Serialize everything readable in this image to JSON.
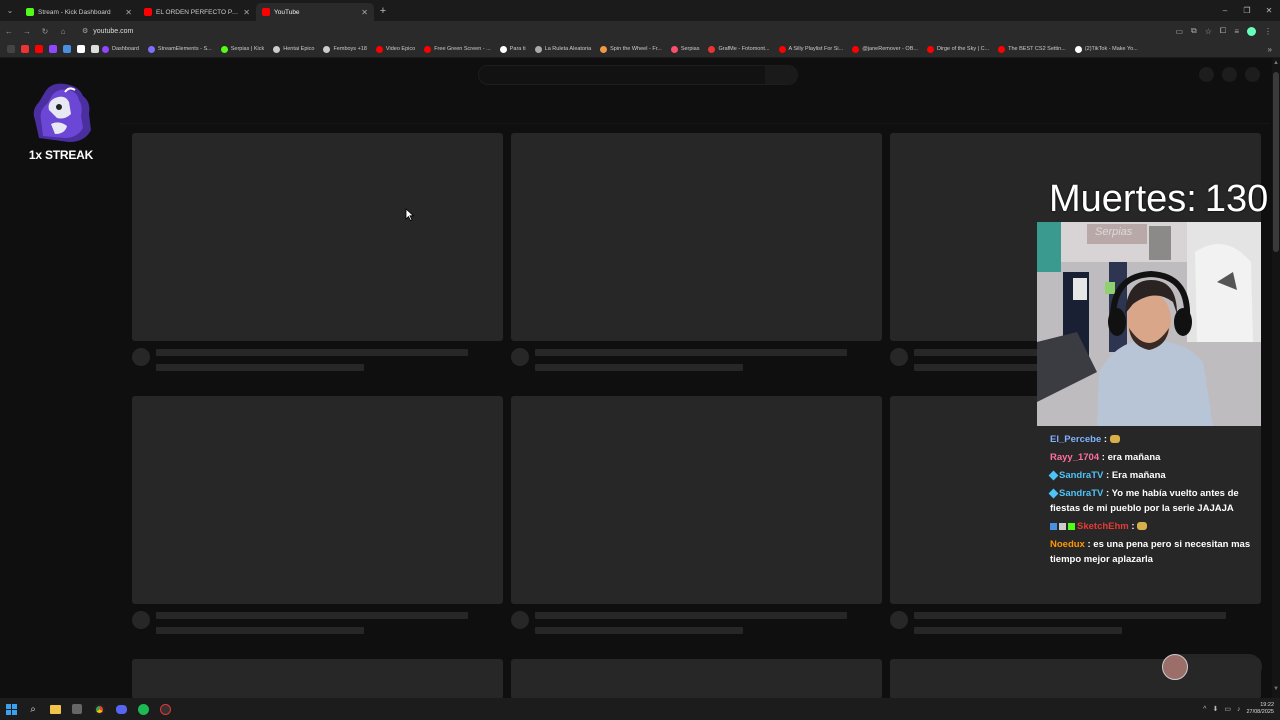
{
  "browser": {
    "tabs": [
      {
        "title": "Stream - Kick Dashboard",
        "favicon_color": "#53fc18",
        "active": false
      },
      {
        "title": "EL ORDEN PERFECTO PARA JU",
        "favicon_color": "#ff0000",
        "active": false
      },
      {
        "title": "YouTube",
        "favicon_color": "#ff0000",
        "active": true
      }
    ],
    "url": "youtube.com",
    "bookmarks": [
      {
        "label": "Dashboard",
        "color": "#9146ff"
      },
      {
        "label": "StreamElements - S...",
        "color": "#7e6ffd"
      },
      {
        "label": "Serpias | Kick",
        "color": "#53fc18"
      },
      {
        "label": "Hentai Epico",
        "color": "#cccccc"
      },
      {
        "label": "Femboys +18",
        "color": "#cccccc"
      },
      {
        "label": "Video Epico",
        "color": "#ff0000"
      },
      {
        "label": "Free Green Screen - ...",
        "color": "#ff0000"
      },
      {
        "label": "Para ti",
        "color": "#ffffff"
      },
      {
        "label": "La Ruleta Aleatoria",
        "color": "#aaaaaa"
      },
      {
        "label": "Spin the Wheel - Fr...",
        "color": "#e94"
      },
      {
        "label": "Serpias",
        "color": "#ff4d6d"
      },
      {
        "label": "GrafMe - Fotomont...",
        "color": "#e33"
      },
      {
        "label": "A Silly Playlist For Si...",
        "color": "#ff0000"
      },
      {
        "label": "@janeRemover - OB...",
        "color": "#ff0000"
      },
      {
        "label": "Dirge of the Sky | C...",
        "color": "#ff0000"
      },
      {
        "label": "The BEST CS2 Settin...",
        "color": "#ff0000"
      },
      {
        "label": "(2)TikTok - Make Yo...",
        "color": "#ffffff"
      }
    ]
  },
  "overlay": {
    "streak_label": "1x STREAK",
    "deaths_label": "Muertes:",
    "deaths_count": "130",
    "webcam_sign": "Serpias",
    "chat": [
      {
        "user": "El_Percebe",
        "user_color": "#7fb2ff",
        "text": "",
        "emote": true
      },
      {
        "user": "Rayy_1704",
        "user_color": "#ff6f9f",
        "text": "era mañana"
      },
      {
        "user": "SandraTV",
        "user_color": "#4fc3f7",
        "text": "Era mañana",
        "badge": true
      },
      {
        "user": "SandraTV",
        "user_color": "#4fc3f7",
        "text": "Yo me había vuelto antes de fiestas de mi pueblo por la serie JAJAJA",
        "badge": true
      },
      {
        "user": "SketchEhm",
        "user_color": "#e53935",
        "text": "",
        "badges3": true,
        "emote": true
      },
      {
        "user": "Noedux",
        "user_color": "#ff9800",
        "text": "es una pena pero si necesitan mas tiempo mejor aplazarla"
      }
    ]
  },
  "taskbar": {
    "time": "19:22",
    "date": "27/08/2025"
  }
}
